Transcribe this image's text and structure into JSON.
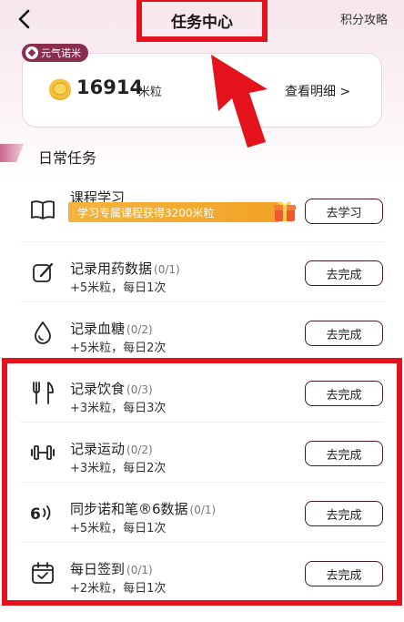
{
  "header": {
    "title": "任务中心",
    "guide_link": "积分攻略"
  },
  "points_card": {
    "brand": "元气诺米",
    "value": "16914",
    "unit": "米粒",
    "detail_link": "查看明细 >"
  },
  "section": {
    "title": "日常任务"
  },
  "tasks": [
    {
      "icon": "book-icon",
      "name": "课程学习",
      "progress": "",
      "reward": "",
      "promo": "学习专属课程获得3200米粒",
      "button": "去学习"
    },
    {
      "icon": "edit-icon",
      "name": "记录用药数据",
      "progress": "(0/1)",
      "reward": "+5米粒，每日1次",
      "button": "去完成"
    },
    {
      "icon": "drop-icon",
      "name": "记录血糖",
      "progress": "(0/2)",
      "reward": "+5米粒，每日2次",
      "button": "去完成"
    },
    {
      "icon": "fork-knife-icon",
      "name": "记录饮食",
      "progress": "(0/3)",
      "reward": "+3米粒，每日3次",
      "button": "去完成"
    },
    {
      "icon": "dumbbell-icon",
      "name": "记录运动",
      "progress": "(0/2)",
      "reward": "+3米粒，每日2次",
      "button": "去完成"
    },
    {
      "icon": "sync-device-icon",
      "name": "同步诺和笔®6数据",
      "progress": "(0/1)",
      "reward": "+5米粒，每日1次",
      "button": "去完成"
    },
    {
      "icon": "calendar-check-icon",
      "name": "每日签到",
      "progress": "(0/1)",
      "reward": "+2米粒，每日1次",
      "button": "去完成"
    }
  ],
  "colors": {
    "annotation_red": "#e4121c",
    "brand_maroon": "#8a2e4f",
    "button_border": "#4a1a2c",
    "promo_orange": "#f5b43d"
  }
}
